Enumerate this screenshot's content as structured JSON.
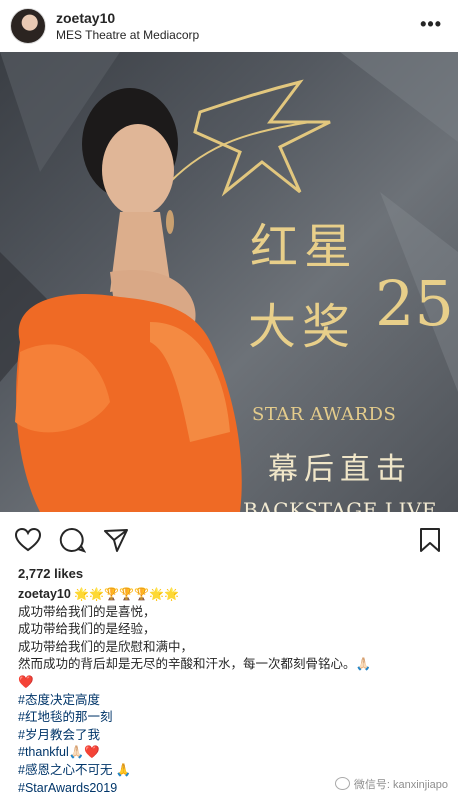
{
  "header": {
    "username": "zoetay10",
    "location": "MES Theatre at Mediacorp",
    "more_icon": "•••"
  },
  "photo": {
    "logo_chinese_line1": "红星",
    "logo_chinese_line2": "大奖",
    "logo_number": "25",
    "logo_english": "STAR AWARDS",
    "subtitle_chinese": "幕后直击",
    "subtitle_english": "BACKSTAGE LIVE"
  },
  "post": {
    "likes": "2,772 likes",
    "caption_user": "zoetay10",
    "caption_emojis": "🌟🌟🏆🏆🏆🌟🌟",
    "lines": [
      "成功带给我们的是喜悦，",
      "成功带给我们的是经验，",
      "成功带给我们的是欣慰和满中，",
      "然而成功的背后却是无尽的辛酸和汗水，每一次都刻骨铭心。🙏🏻"
    ],
    "heart": "❤️",
    "hashtags": [
      "#态度决定高度",
      "#红地毯的那一刻",
      "#岁月教会了我",
      "#thankful🙏🏻❤️",
      "#感恩之心不可无 🙏",
      "#StarAwards2019"
    ]
  },
  "watermark": "微信号: kanxinjiapo"
}
